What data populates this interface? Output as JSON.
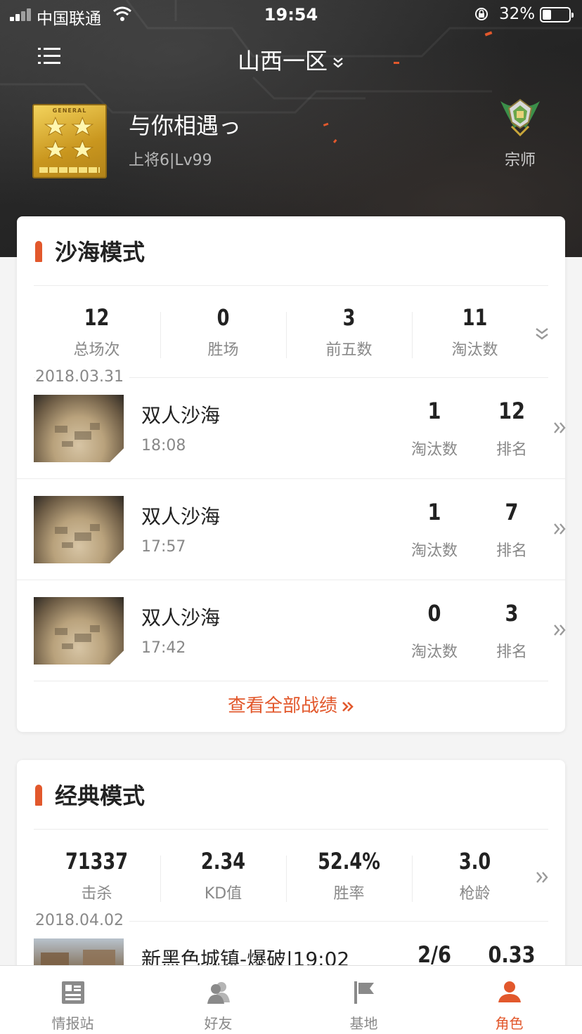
{
  "status_bar": {
    "carrier": "中国联通",
    "time": "19:54",
    "battery": "32%"
  },
  "header": {
    "server": "山西一区",
    "rank_badge_text": "GENERAL",
    "nickname": "与你相遇っ",
    "rank_level": "上将6|Lv99",
    "title": "宗师"
  },
  "sand_mode": {
    "title": "沙海模式",
    "stats": [
      {
        "value": "12",
        "label": "总场次"
      },
      {
        "value": "0",
        "label": "胜场"
      },
      {
        "value": "3",
        "label": "前五数"
      },
      {
        "value": "11",
        "label": "淘汰数"
      }
    ],
    "date": "2018.03.31",
    "matches": [
      {
        "mode": "双人沙海",
        "time": "18:08",
        "kills": "1",
        "kills_label": "淘汰数",
        "rank": "12",
        "rank_label": "排名"
      },
      {
        "mode": "双人沙海",
        "time": "17:57",
        "kills": "1",
        "kills_label": "淘汰数",
        "rank": "7",
        "rank_label": "排名"
      },
      {
        "mode": "双人沙海",
        "time": "17:42",
        "kills": "0",
        "kills_label": "淘汰数",
        "rank": "3",
        "rank_label": "排名"
      }
    ],
    "view_all": "查看全部战绩"
  },
  "classic_mode": {
    "title": "经典模式",
    "stats": [
      {
        "value": "71337",
        "label": "击杀"
      },
      {
        "value": "2.34",
        "label": "KD值"
      },
      {
        "value": "52.4%",
        "label": "胜率"
      },
      {
        "value": "3.0",
        "label": "枪龄"
      }
    ],
    "date": "2018.04.02",
    "matches": [
      {
        "mode": "新黑色城镇-爆破|19:02",
        "kd": "2/6",
        "ratio": "0.33"
      }
    ]
  },
  "tabbar": [
    {
      "label": "情报站",
      "icon": "news-icon"
    },
    {
      "label": "好友",
      "icon": "friends-icon"
    },
    {
      "label": "基地",
      "icon": "flag-icon"
    },
    {
      "label": "角色",
      "icon": "person-icon"
    }
  ],
  "colors": {
    "accent": "#e2582c",
    "hero_bg": "#262626",
    "text_primary": "#222222",
    "text_secondary": "#888888"
  }
}
